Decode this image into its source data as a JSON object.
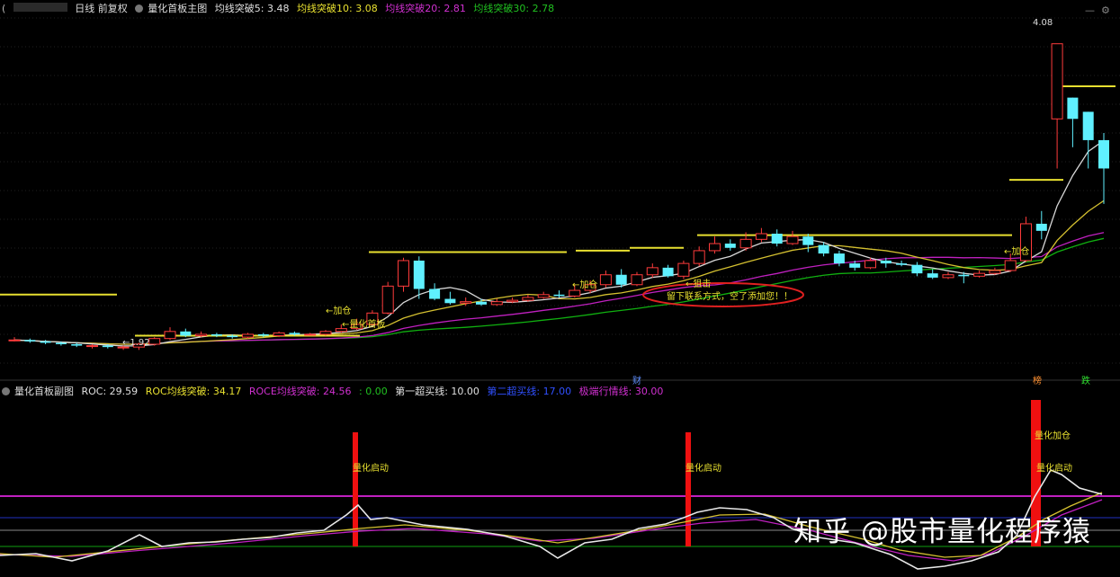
{
  "main_header": {
    "label_a": "(",
    "period": "日线 前复权",
    "indicator_name": "量化首板主图",
    "ma5": "均线突破5: 3.48",
    "ma10": "均线突破10: 3.08",
    "ma20": "均线突破20: 2.81",
    "ma30": "均线突破30: 2.78"
  },
  "sub_header": {
    "indicator_name": "量化首板副图",
    "roc": "ROC: 29.59",
    "roc_ma": "ROC均线突破: 34.17",
    "roce_ma": "ROCE均线突破: 24.56",
    "zero": ": 0.00",
    "line1": "第一超买线: 10.00",
    "line2": "第二超买线: 17.00",
    "line3": "极端行情线: 30.00"
  },
  "annotations": {
    "price_high": "4.08",
    "price_low": "←1.92",
    "first_board": "←量化首板",
    "add_pos": "←加仓",
    "ambush": "←狙击",
    "contact": "留下联系方式，空了添加您！！",
    "qidong": "量化启动",
    "jiacang": "量化加仓",
    "badge_cai": "财",
    "badge_bang": "榜",
    "badge_die": "跌"
  },
  "colors": {
    "up": "#ff3b3b",
    "down": "#5ff0ff",
    "ma5": "#d8d8d8",
    "ma10": "#d4c030",
    "ma20": "#c020c0",
    "ma30": "#10b010",
    "board": "#e8e030"
  },
  "chart_data": [
    {
      "type": "candlestick",
      "title": "量化首板主图",
      "price_range": [
        1.7,
        4.3
      ],
      "labeled_high": 4.08,
      "labeled_low": 1.92,
      "series": [
        {
          "name": "均线突破5",
          "last": 3.48
        },
        {
          "name": "均线突破10",
          "last": 3.08
        },
        {
          "name": "均线突破20",
          "last": 2.81
        },
        {
          "name": "均线突破30",
          "last": 2.78
        }
      ],
      "candles": [
        [
          1.99,
          1.99,
          2.01,
          1.98
        ],
        [
          1.99,
          1.98,
          2.0,
          1.97
        ],
        [
          1.98,
          1.97,
          1.99,
          1.96
        ],
        [
          1.97,
          1.96,
          1.98,
          1.95
        ],
        [
          1.96,
          1.95,
          1.97,
          1.94
        ],
        [
          1.95,
          1.95,
          1.96,
          1.93
        ],
        [
          1.95,
          1.94,
          1.96,
          1.93
        ],
        [
          1.94,
          1.94,
          1.95,
          1.92
        ],
        [
          1.94,
          1.96,
          1.97,
          1.92
        ],
        [
          1.96,
          2.0,
          2.01,
          1.95
        ],
        [
          2.0,
          2.05,
          2.08,
          1.99
        ],
        [
          2.05,
          2.02,
          2.07,
          2.01
        ],
        [
          2.02,
          2.03,
          2.05,
          2.01
        ],
        [
          2.03,
          2.02,
          2.04,
          2.01
        ],
        [
          2.02,
          2.01,
          2.03,
          2.0
        ],
        [
          2.01,
          2.03,
          2.04,
          2.0
        ],
        [
          2.03,
          2.02,
          2.04,
          2.01
        ],
        [
          2.02,
          2.04,
          2.05,
          2.01
        ],
        [
          2.04,
          2.03,
          2.05,
          2.02
        ],
        [
          2.03,
          2.03,
          2.04,
          2.02
        ],
        [
          2.03,
          2.05,
          2.06,
          2.02
        ],
        [
          2.05,
          2.07,
          2.1,
          2.04
        ],
        [
          2.07,
          2.1,
          2.14,
          2.06
        ],
        [
          2.1,
          2.18,
          2.2,
          2.09
        ],
        [
          2.18,
          2.37,
          2.4,
          2.17
        ],
        [
          2.37,
          2.55,
          2.57,
          2.33
        ],
        [
          2.55,
          2.35,
          2.58,
          2.28
        ],
        [
          2.35,
          2.28,
          2.39,
          2.27
        ],
        [
          2.28,
          2.25,
          2.33,
          2.24
        ],
        [
          2.25,
          2.26,
          2.29,
          2.23
        ],
        [
          2.26,
          2.24,
          2.28,
          2.23
        ],
        [
          2.24,
          2.26,
          2.28,
          2.23
        ],
        [
          2.26,
          2.27,
          2.29,
          2.25
        ],
        [
          2.27,
          2.29,
          2.31,
          2.26
        ],
        [
          2.29,
          2.31,
          2.33,
          2.28
        ],
        [
          2.31,
          2.3,
          2.34,
          2.29
        ],
        [
          2.3,
          2.34,
          2.38,
          2.29
        ],
        [
          2.34,
          2.38,
          2.41,
          2.32
        ],
        [
          2.38,
          2.45,
          2.48,
          2.36
        ],
        [
          2.45,
          2.38,
          2.49,
          2.36
        ],
        [
          2.38,
          2.45,
          2.47,
          2.37
        ],
        [
          2.45,
          2.5,
          2.53,
          2.43
        ],
        [
          2.5,
          2.44,
          2.52,
          2.43
        ],
        [
          2.44,
          2.53,
          2.55,
          2.42
        ],
        [
          2.53,
          2.62,
          2.65,
          2.51
        ],
        [
          2.62,
          2.67,
          2.72,
          2.6
        ],
        [
          2.67,
          2.64,
          2.7,
          2.62
        ],
        [
          2.64,
          2.7,
          2.75,
          2.62
        ],
        [
          2.7,
          2.74,
          2.78,
          2.68
        ],
        [
          2.74,
          2.67,
          2.77,
          2.65
        ],
        [
          2.67,
          2.72,
          2.76,
          2.66
        ],
        [
          2.72,
          2.66,
          2.74,
          2.61
        ],
        [
          2.66,
          2.6,
          2.68,
          2.58
        ],
        [
          2.6,
          2.53,
          2.62,
          2.51
        ],
        [
          2.53,
          2.5,
          2.55,
          2.48
        ],
        [
          2.5,
          2.55,
          2.57,
          2.49
        ],
        [
          2.55,
          2.53,
          2.57,
          2.5
        ],
        [
          2.53,
          2.52,
          2.55,
          2.51
        ],
        [
          2.52,
          2.46,
          2.54,
          2.44
        ],
        [
          2.46,
          2.43,
          2.49,
          2.42
        ],
        [
          2.43,
          2.45,
          2.47,
          2.42
        ],
        [
          2.45,
          2.44,
          2.47,
          2.39
        ],
        [
          2.44,
          2.46,
          2.48,
          2.43
        ],
        [
          2.46,
          2.48,
          2.5,
          2.45
        ],
        [
          2.48,
          2.55,
          2.6,
          2.47
        ],
        [
          2.55,
          2.81,
          2.86,
          2.54
        ],
        [
          2.81,
          2.76,
          2.9,
          2.7
        ],
        [
          3.55,
          4.08,
          4.08,
          3.2
        ],
        [
          3.7,
          3.55,
          3.7,
          3.35
        ],
        [
          3.6,
          3.4,
          3.6,
          3.2
        ],
        [
          3.4,
          3.2,
          3.45,
          2.95
        ]
      ]
    },
    {
      "type": "line",
      "title": "量化首板副图",
      "series": [
        {
          "name": "ROC",
          "last": 29.59
        },
        {
          "name": "ROC均线突破",
          "last": 34.17
        },
        {
          "name": "ROCE均线突破",
          "last": 24.56
        },
        {
          "name": "第一超买线",
          "value": 10.0
        },
        {
          "name": "第二超买线",
          "value": 17.0
        },
        {
          "name": "极端行情线",
          "value": 30.0
        }
      ],
      "signals": [
        "量化启动",
        "量化启动",
        "量化加仓",
        "量化启动"
      ]
    }
  ]
}
